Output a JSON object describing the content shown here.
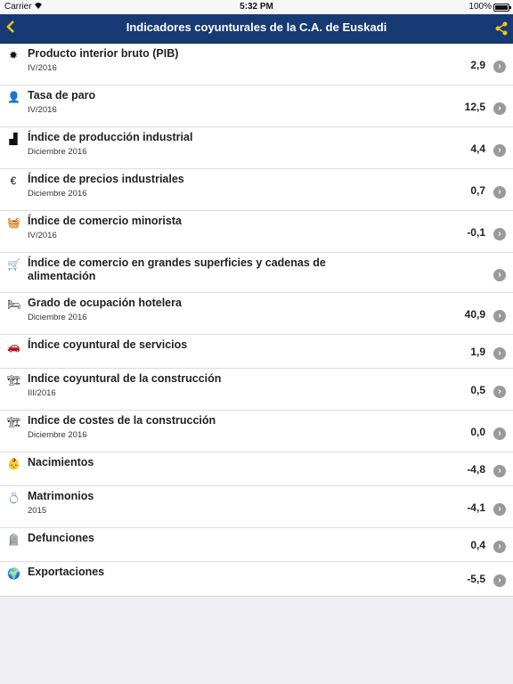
{
  "status": {
    "carrier": "Carrier",
    "time": "5:32 PM",
    "battery": "100%"
  },
  "header": {
    "title": "Indicadores coyunturales de la C.A. de Euskadi"
  },
  "items": [
    {
      "title": "Producto interior bruto (PIB)",
      "subtitle": "IV/2016",
      "value": "2,9",
      "icon": "gear-icon",
      "glyph": "✹"
    },
    {
      "title": "Tasa de paro",
      "subtitle": "IV/2016",
      "value": "12,5",
      "icon": "person-icon",
      "glyph": "👤"
    },
    {
      "title": "Índice de producción industrial",
      "subtitle": "Diciembre 2016",
      "value": "4,4",
      "icon": "factory-icon",
      "glyph": "▟"
    },
    {
      "title": "Índice de precios industriales",
      "subtitle": "Diciembre 2016",
      "value": "0,7",
      "icon": "euro-icon",
      "glyph": "€"
    },
    {
      "title": "Índice de comercio minorista",
      "subtitle": "IV/2016",
      "value": "-0,1",
      "icon": "basket-icon",
      "glyph": "🧺"
    },
    {
      "title": "Índice de comercio en grandes superficies y cadenas de alimentación",
      "subtitle": "",
      "value": "",
      "icon": "cart-icon",
      "glyph": "🛒"
    },
    {
      "title": "Grado de ocupación hotelera",
      "subtitle": "Diciembre 2016",
      "value": "40,9",
      "icon": "bed-icon",
      "glyph": "🛏"
    },
    {
      "title": "Índice coyuntural de servicios",
      "subtitle": "",
      "value": "1,9",
      "icon": "car-icon",
      "glyph": "🚗"
    },
    {
      "title": "Indice coyuntural de la construcción",
      "subtitle": "III/2016",
      "value": "0,5",
      "icon": "crane-icon",
      "glyph": "🏗"
    },
    {
      "title": "Indice de costes de la construcción",
      "subtitle": "Diciembre 2016",
      "value": "0,0",
      "icon": "crane-euro-icon",
      "glyph": "🏗"
    },
    {
      "title": "Nacimientos",
      "subtitle": "",
      "value": "-4,8",
      "icon": "baby-icon",
      "glyph": "👶"
    },
    {
      "title": "Matrimonios",
      "subtitle": "2015",
      "value": "-4,1",
      "icon": "rings-icon",
      "glyph": "💍"
    },
    {
      "title": "Defunciones",
      "subtitle": "",
      "value": "0,4",
      "icon": "tombstone-icon",
      "glyph": "🪦"
    },
    {
      "title": "Exportaciones",
      "subtitle": "",
      "value": "-5,5",
      "icon": "globe-icon",
      "glyph": "🌍"
    }
  ]
}
